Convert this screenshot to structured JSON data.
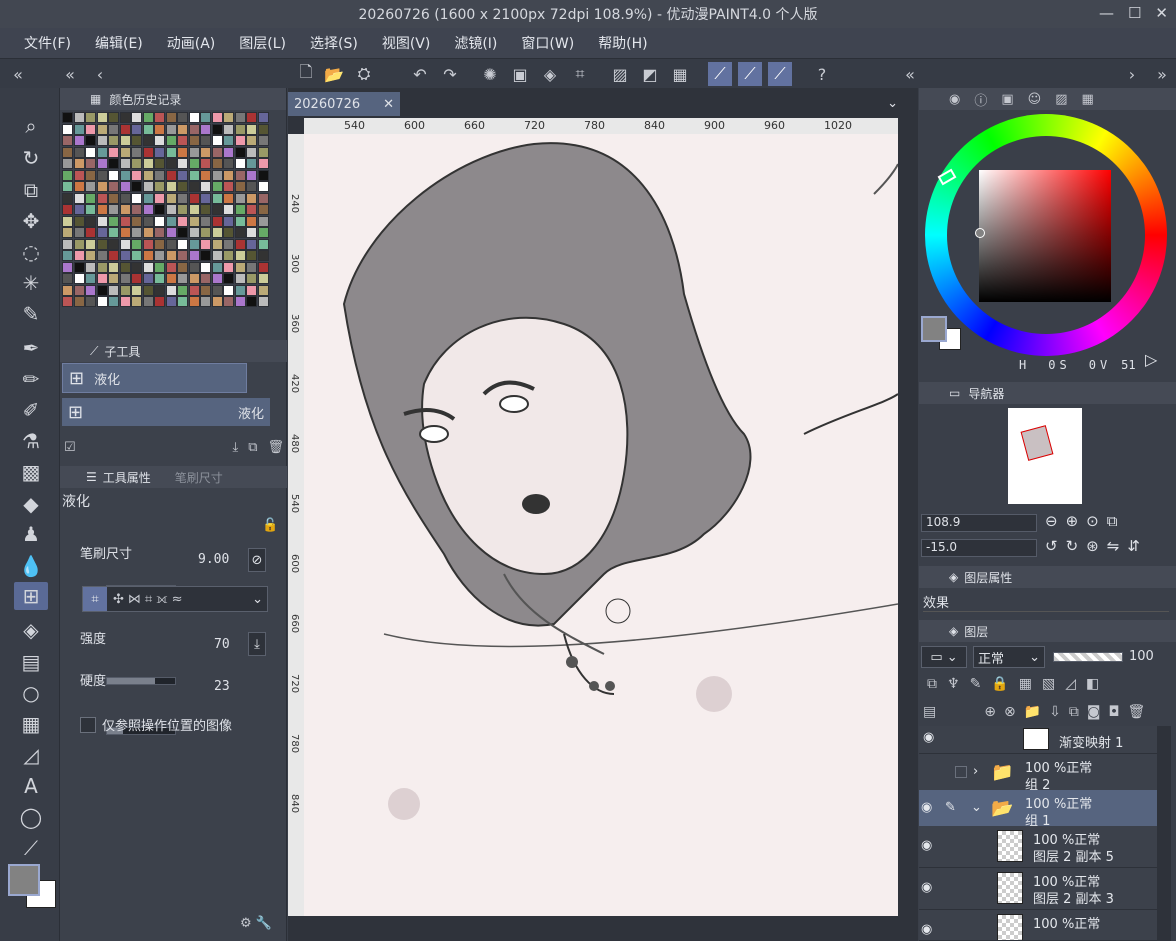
{
  "title": "20260726 (1600 x 2100px 72dpi 108.9%)  - 优动漫PAINT4.0 个人版",
  "menu": [
    "文件(F)",
    "编辑(E)",
    "动画(A)",
    "图层(L)",
    "选择(S)",
    "视图(V)",
    "滤镜(I)",
    "窗口(W)",
    "帮助(H)"
  ],
  "panels": {
    "color_history": "颜色历史记录",
    "subtool": "子工具",
    "tool_property": "工具属性",
    "brush_size_tab": "笔刷尺寸",
    "navigator": "导航器",
    "layer_property": "图层属性",
    "layer": "图层"
  },
  "subtool": {
    "group": "液化",
    "item": "液化"
  },
  "toolprop": {
    "name": "液化",
    "brush_size_label": "笔刷尺寸",
    "brush_size_value": "9.00",
    "strength_label": "强度",
    "strength_value": "70",
    "strength_fraction": 0.7,
    "hardness_label": "硬度",
    "hardness_value": "23",
    "hardness_fraction": 0.23,
    "ref_label": "仅参照操作位置的图像"
  },
  "canvas": {
    "tab": "20260726",
    "ruler_h": [
      "540",
      "600",
      "660",
      "720",
      "780",
      "840",
      "900",
      "960",
      "1020"
    ],
    "ruler_v": [
      "240",
      "300",
      "360",
      "420",
      "480",
      "540",
      "600",
      "660",
      "720",
      "780",
      "840"
    ]
  },
  "color": {
    "h": "0",
    "s": "0",
    "v": "51",
    "h_label": "H",
    "s_label": "S",
    "v_label": "V",
    "main": "#828282",
    "sub": "#ffffff"
  },
  "navigator": {
    "zoom": "108.9",
    "angle": "-15.0"
  },
  "layerprop": {
    "effect": "效果"
  },
  "layers": {
    "blend_mode": "正常",
    "opacity": "100",
    "items": [
      {
        "line1": "",
        "line2": "渐变映射 1"
      },
      {
        "line1": "100 %正常",
        "line2": "组 2"
      },
      {
        "line1": "100 %正常",
        "line2": "组 1"
      },
      {
        "line1": "100 %正常",
        "line2": "图层 2 副本 5"
      },
      {
        "line1": "100 %正常",
        "line2": "图层 2 副本 3"
      },
      {
        "line1": "100 %正常",
        "line2": ""
      }
    ]
  },
  "accent": "#5a6a96"
}
